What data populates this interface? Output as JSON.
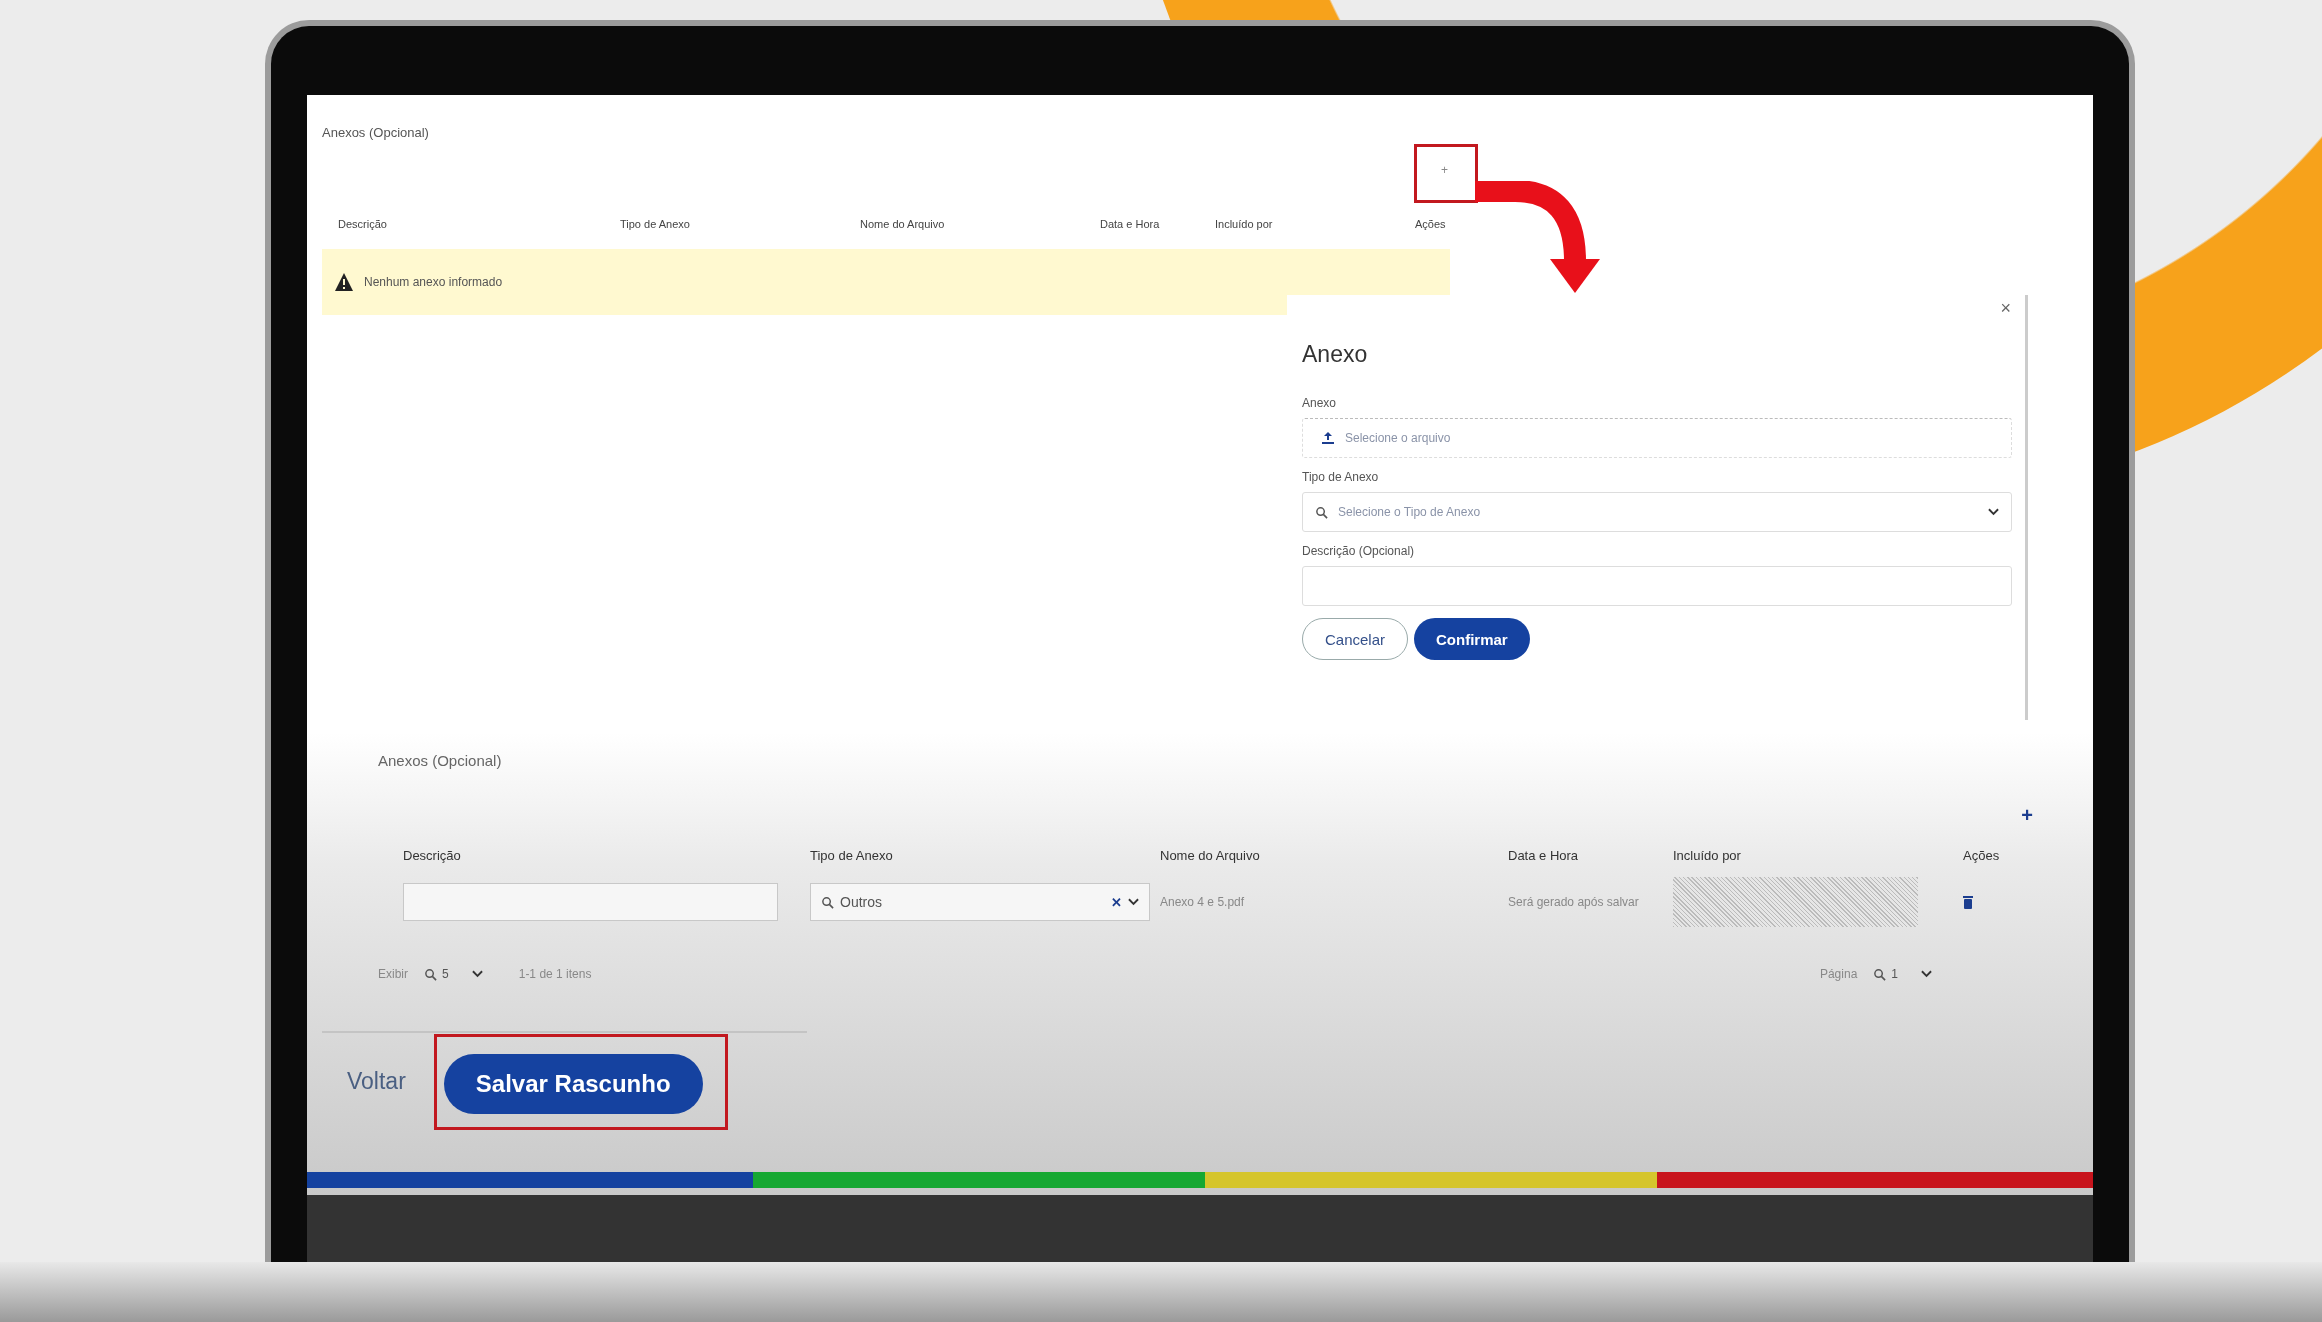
{
  "top_section": {
    "title": "Anexos (Opcional)",
    "add_button": "+",
    "columns": [
      "Descrição",
      "Tipo de Anexo",
      "Nome do Arquivo",
      "Data e Hora",
      "Incluído por",
      "Ações"
    ],
    "empty_message": "Nenhum anexo informado"
  },
  "modal": {
    "title": "Anexo",
    "close": "×",
    "fields": [
      {
        "kind": "file",
        "label": "Anexo",
        "placeholder": "Selecione o arquivo"
      },
      {
        "kind": "select",
        "label": "Tipo de Anexo",
        "placeholder": "Selecione o Tipo de Anexo"
      },
      {
        "kind": "text",
        "label": "Descrição (Opcional)"
      }
    ],
    "buttons": [
      {
        "kind": "secondary",
        "label": "Cancelar"
      },
      {
        "kind": "primary",
        "label": "Confirmar"
      }
    ]
  },
  "attachments": {
    "title": "Anexos (Opcional)",
    "add_button": "+",
    "columns": [
      "Descrição",
      "Tipo de Anexo",
      "Nome do Arquivo",
      "Data e Hora",
      "Incluído por",
      "Ações"
    ],
    "rows": [
      {
        "type": "Outros",
        "clear_button": "✕",
        "file_name": "Anexo 4 e 5.pdf",
        "date": "Será gerado após salvar"
      }
    ],
    "pager": {
      "show_label": "Exibir",
      "page_size": "5",
      "range": "1-1 de 1 itens",
      "page_label": "Página",
      "page": "1"
    }
  },
  "footer": {
    "back": "Voltar",
    "save": "Salvar Rascunho"
  }
}
